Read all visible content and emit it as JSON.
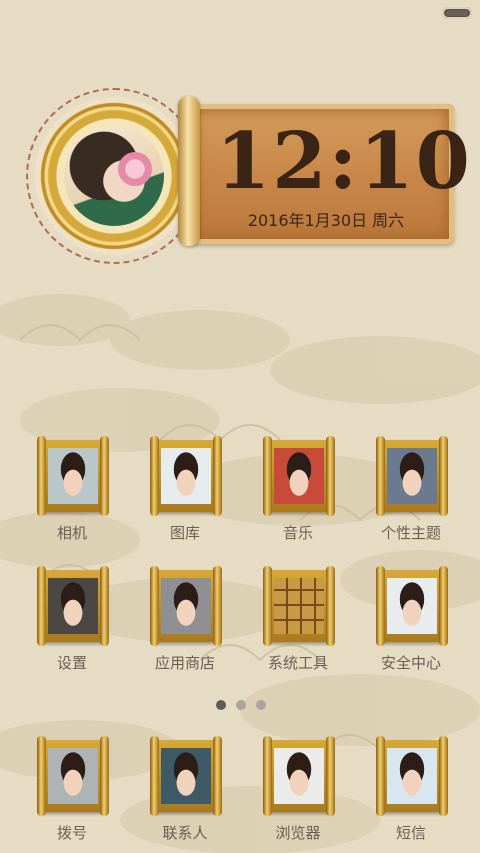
{
  "status_bar": {
    "battery_icon": "battery-icon"
  },
  "widget": {
    "time": "12:10",
    "date": "2016年1月30日 周六"
  },
  "apps": [
    {
      "label": "相机",
      "icon": "camera-icon",
      "bg": "#b9c7c9"
    },
    {
      "label": "图库",
      "icon": "gallery-icon",
      "bg": "#e6ebee"
    },
    {
      "label": "音乐",
      "icon": "music-icon",
      "bg": "#c84a3a"
    },
    {
      "label": "个性主题",
      "icon": "theme-icon",
      "bg": "#6b7a8e"
    },
    {
      "label": "设置",
      "icon": "settings-icon",
      "bg": "#4b4743"
    },
    {
      "label": "应用商店",
      "icon": "app-store-icon",
      "bg": "#8e8f93"
    },
    {
      "label": "系统工具",
      "icon": "system-tools-icon",
      "bg": "#c89a45"
    },
    {
      "label": "安全中心",
      "icon": "security-center-icon",
      "bg": "#e9ecee"
    }
  ],
  "page_indicator": {
    "pages": 3,
    "active": 1
  },
  "dock": [
    {
      "label": "拨号",
      "icon": "phone-icon",
      "bg": "#aeb4b6"
    },
    {
      "label": "联系人",
      "icon": "contacts-icon",
      "bg": "#3d5a66"
    },
    {
      "label": "浏览器",
      "icon": "browser-icon",
      "bg": "#ebebea"
    },
    {
      "label": "短信",
      "icon": "messages-icon",
      "bg": "#d7e6ef"
    }
  ]
}
